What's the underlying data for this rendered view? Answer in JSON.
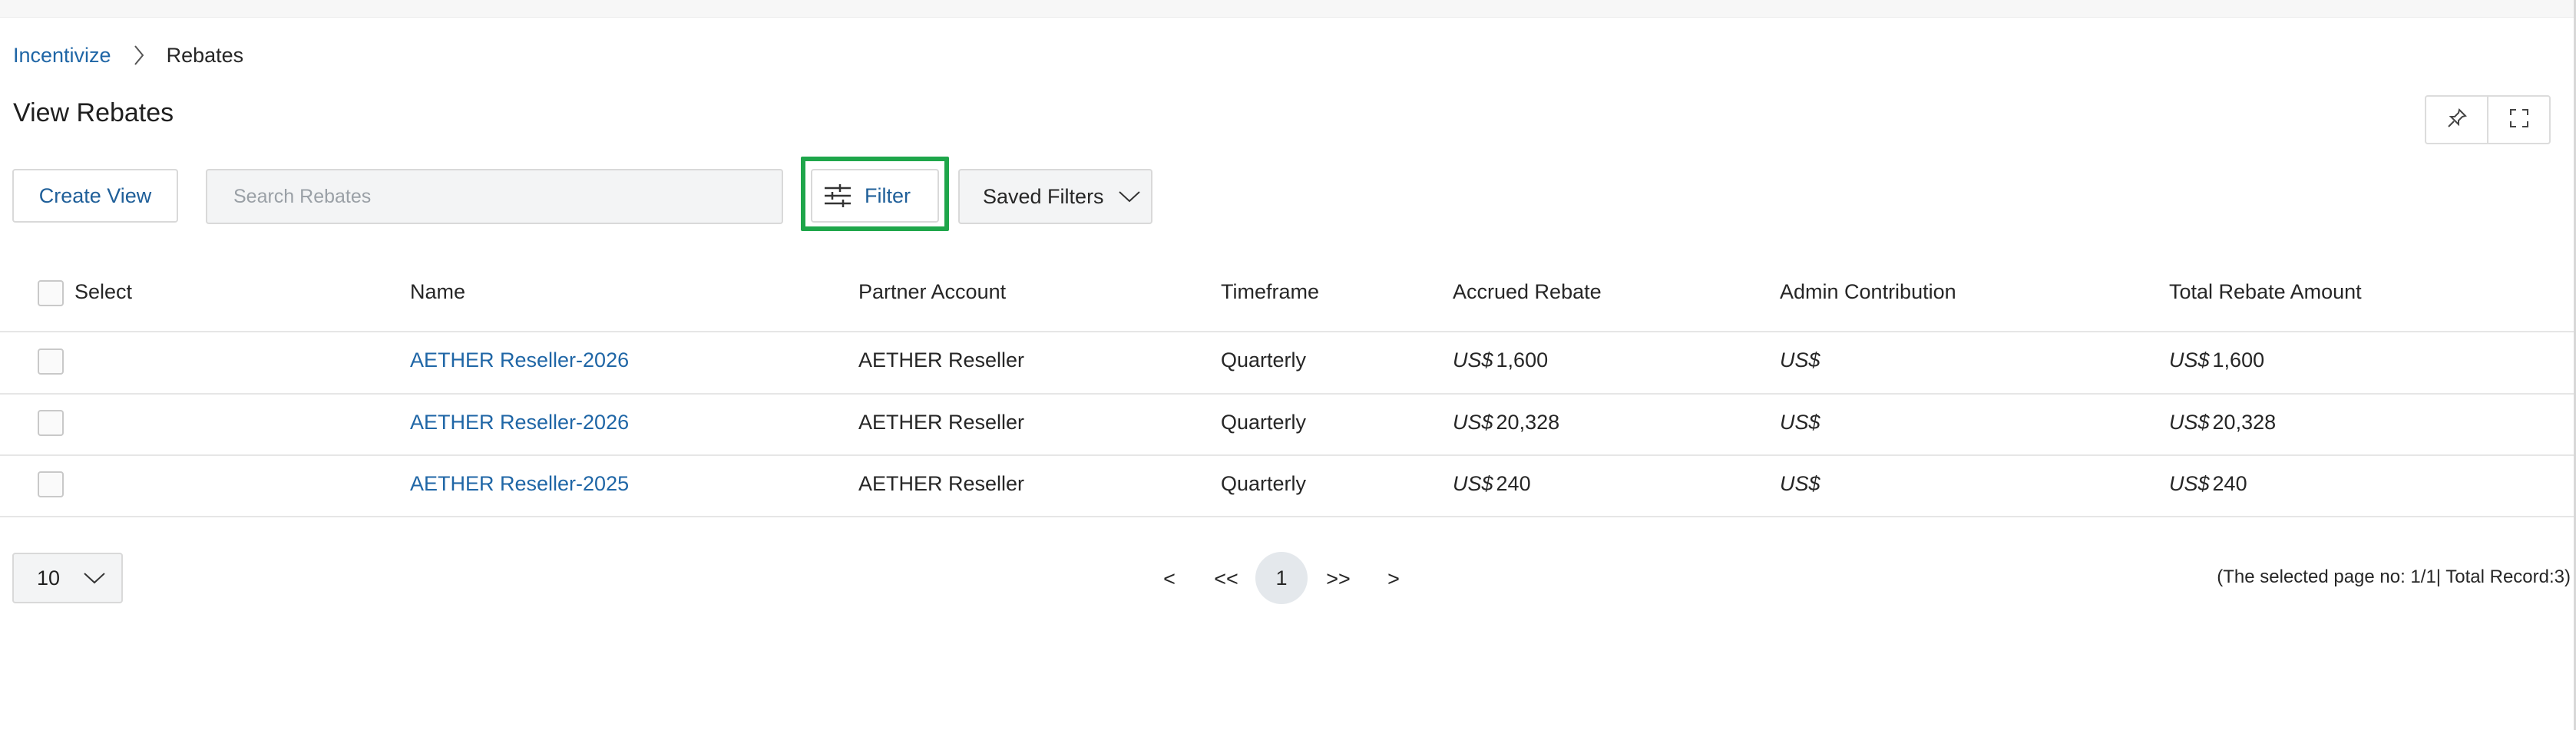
{
  "breadcrumb": {
    "root": "Incentivize",
    "current": "Rebates"
  },
  "page": {
    "title": "View Rebates"
  },
  "toolbar": {
    "create_view_label": "Create View",
    "search_placeholder": "Search Rebates",
    "filter_label": "Filter",
    "saved_filters_label": "Saved Filters"
  },
  "table": {
    "columns": [
      "Select",
      "Name",
      "Partner Account",
      "Timeframe",
      "Accrued Rebate",
      "Admin Contribution",
      "Total Rebate Amount"
    ],
    "currency": "US$",
    "rows": [
      {
        "name": "AETHER Reseller-2026",
        "partner": "AETHER Reseller",
        "timeframe": "Quarterly",
        "accrued": "1,600",
        "admin": "",
        "total": "1,600"
      },
      {
        "name": "AETHER Reseller-2026",
        "partner": "AETHER Reseller",
        "timeframe": "Quarterly",
        "accrued": "20,328",
        "admin": "",
        "total": "20,328"
      },
      {
        "name": "AETHER Reseller-2025",
        "partner": "AETHER Reseller",
        "timeframe": "Quarterly",
        "accrued": "240",
        "admin": "",
        "total": "240"
      }
    ]
  },
  "pagination": {
    "page_size": "10",
    "prev": "<",
    "first": "<<",
    "current": "1",
    "last": ">>",
    "next": ">",
    "info": "(The selected page no: 1/1| Total Record:3)"
  },
  "colors": {
    "link": "#1f66a6",
    "highlight": "#1ea64a"
  }
}
